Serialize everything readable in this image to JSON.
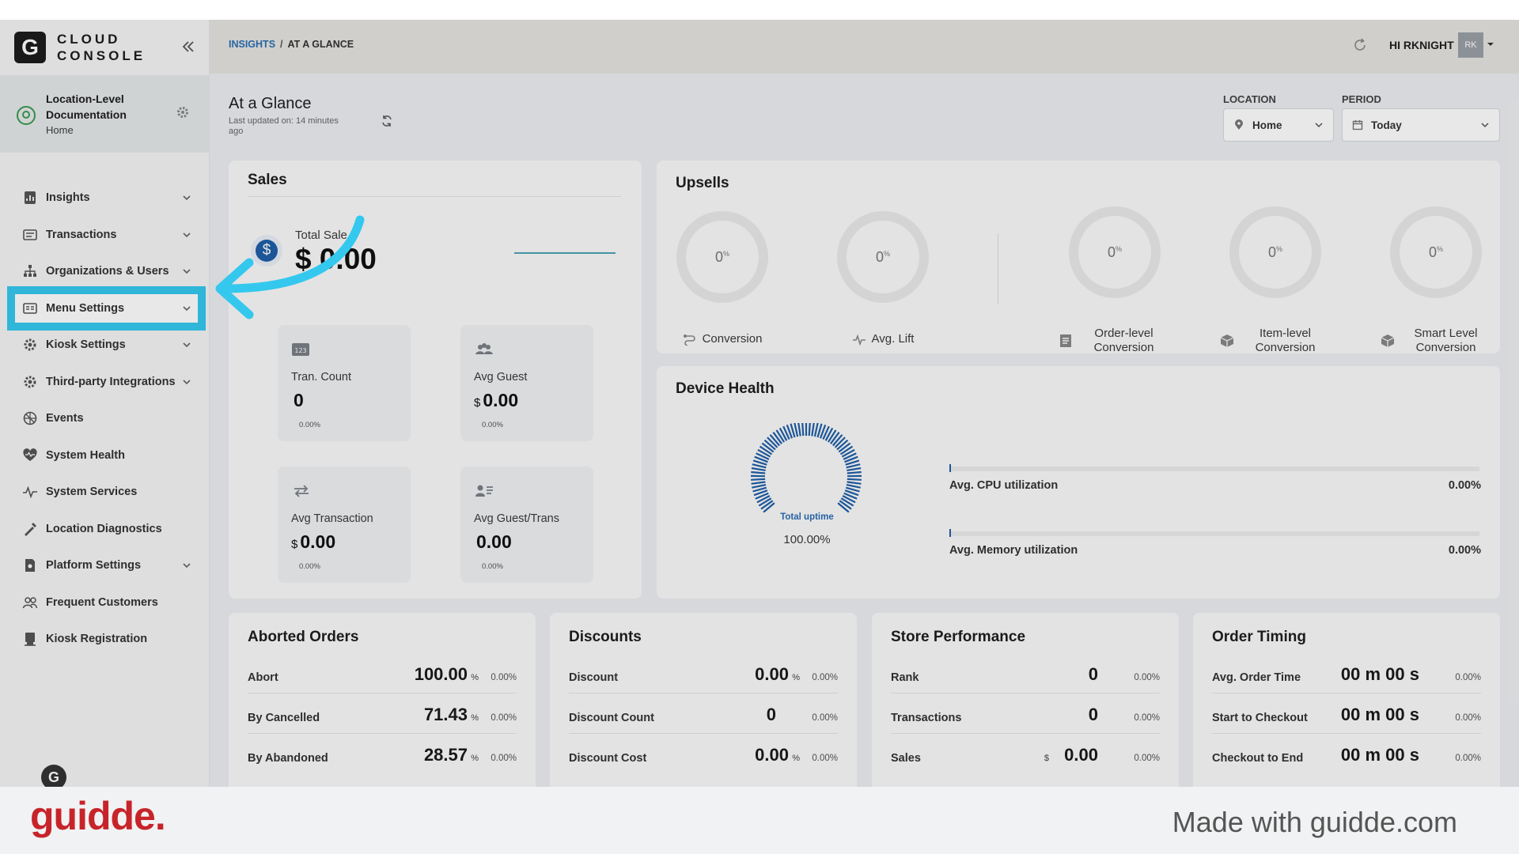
{
  "brand": {
    "logo_letter": "G",
    "line1": "CLOUD",
    "line2": "CONSOLE"
  },
  "location_card": {
    "title": "Location-Level Documentation",
    "subtitle": "Home"
  },
  "sidebar": {
    "items": [
      {
        "label": "Insights",
        "icon": "insights-icon",
        "has_chevron": true
      },
      {
        "label": "Transactions",
        "icon": "transactions-icon",
        "has_chevron": true
      },
      {
        "label": "Organizations & Users",
        "icon": "org-users-icon",
        "has_chevron": true
      },
      {
        "label": "Menu Settings",
        "icon": "menu-settings-icon",
        "has_chevron": true,
        "active": true
      },
      {
        "label": "Kiosk Settings",
        "icon": "kiosk-settings-icon",
        "has_chevron": true
      },
      {
        "label": "Third-party Integrations",
        "icon": "integrations-icon",
        "has_chevron": true
      },
      {
        "label": "Events",
        "icon": "events-icon",
        "has_chevron": false
      },
      {
        "label": "System Health",
        "icon": "heart-icon",
        "has_chevron": false
      },
      {
        "label": "System Services",
        "icon": "pulse-icon",
        "has_chevron": false
      },
      {
        "label": "Location Diagnostics",
        "icon": "diagnostics-icon",
        "has_chevron": false
      },
      {
        "label": "Platform Settings",
        "icon": "platform-settings-icon",
        "has_chevron": true
      },
      {
        "label": "Frequent Customers",
        "icon": "customers-icon",
        "has_chevron": false
      },
      {
        "label": "Kiosk Registration",
        "icon": "kiosk-registration-icon",
        "has_chevron": false
      }
    ],
    "bottom_avatar": "G"
  },
  "header": {
    "breadcrumb_link": "INSIGHTS",
    "breadcrumb_sep": "/",
    "breadcrumb_current": "AT A GLANCE",
    "user_greeting": "HI RKNIGHT",
    "user_initials": "RK"
  },
  "page": {
    "title": "At a Glance",
    "last_updated": "Last updated on: 14 minutes ago",
    "filters": {
      "location_label": "LOCATION",
      "location_value": "Home",
      "period_label": "PERIOD",
      "period_value": "Today"
    }
  },
  "sales": {
    "title": "Sales",
    "total_label": "Total Sale",
    "total_value": "$ 0.00",
    "tiles": [
      {
        "label": "Tran. Count",
        "currency": "",
        "value": "0",
        "pct": "0.00%",
        "icon": "number-icon"
      },
      {
        "label": "Avg Guest",
        "currency": "$",
        "value": "0.00",
        "pct": "0.00%",
        "icon": "guests-icon"
      },
      {
        "label": "Avg Transaction",
        "currency": "$",
        "value": "0.00",
        "pct": "0.00%",
        "icon": "exchange-icon"
      },
      {
        "label": "Avg Guest/Trans",
        "currency": "",
        "value": "0.00",
        "pct": "0.00%",
        "icon": "guest-list-icon"
      }
    ]
  },
  "upsells": {
    "title": "Upsells",
    "metrics": [
      {
        "value": "0",
        "unit": "%",
        "label": "Conversion",
        "icon": "conversion-icon"
      },
      {
        "value": "0",
        "unit": "%",
        "label": "Avg. Lift",
        "icon": "lift-icon"
      },
      {
        "value": "0",
        "unit": "%",
        "label": "Order-level Conversion",
        "icon": "order-icon"
      },
      {
        "value": "0",
        "unit": "%",
        "label": "Item-level Conversion",
        "icon": "item-icon"
      },
      {
        "value": "0",
        "unit": "%",
        "label": "Smart Level Conversion",
        "icon": "smart-icon"
      }
    ]
  },
  "device_health": {
    "title": "Device Health",
    "uptime_label": "Total uptime",
    "uptime_value": "100.00%",
    "uptime_fraction": 1.0,
    "bars": [
      {
        "label": "Avg. CPU utilization",
        "value": "0.00%"
      },
      {
        "label": "Avg. Memory utilization",
        "value": "0.00%"
      }
    ]
  },
  "stat_cards": [
    {
      "title": "Aborted Orders",
      "rows": [
        {
          "label": "Abort",
          "currency": "",
          "value": "100.00",
          "unit": "%",
          "pct": "0.00%"
        },
        {
          "label": "By Cancelled",
          "currency": "",
          "value": "71.43",
          "unit": "%",
          "pct": "0.00%"
        },
        {
          "label": "By Abandoned",
          "currency": "",
          "value": "28.57",
          "unit": "%",
          "pct": "0.00%"
        }
      ]
    },
    {
      "title": "Discounts",
      "rows": [
        {
          "label": "Discount",
          "currency": "",
          "value": "0.00",
          "unit": "%",
          "pct": "0.00%"
        },
        {
          "label": "Discount Count",
          "currency": "",
          "value": "0",
          "unit": "",
          "pct": "0.00%"
        },
        {
          "label": "Discount Cost",
          "currency": "",
          "value": "0.00",
          "unit": "%",
          "pct": "0.00%"
        }
      ]
    },
    {
      "title": "Store Performance",
      "rows": [
        {
          "label": "Rank",
          "currency": "",
          "value": "0",
          "unit": "",
          "pct": "0.00%"
        },
        {
          "label": "Transactions",
          "currency": "",
          "value": "0",
          "unit": "",
          "pct": "0.00%"
        },
        {
          "label": "Sales",
          "currency": "$",
          "value": "0.00",
          "unit": "",
          "pct": "0.00%"
        }
      ]
    },
    {
      "title": "Order Timing",
      "rows": [
        {
          "label": "Avg. Order Time",
          "currency": "",
          "value": "00 m 00 s",
          "unit": "",
          "pct": "0.00%"
        },
        {
          "label": "Start to Checkout",
          "currency": "",
          "value": "00 m 00 s",
          "unit": "",
          "pct": "0.00%"
        },
        {
          "label": "Checkout to End",
          "currency": "",
          "value": "00 m 00 s",
          "unit": "",
          "pct": "0.00%"
        }
      ]
    }
  ],
  "footer": {
    "logo": "guidde.",
    "made_with": "Made with guidde.com"
  },
  "colors": {
    "highlight": "#34c8ee",
    "accent_blue": "#1f5fa8",
    "guidde_red": "#c7242a"
  }
}
